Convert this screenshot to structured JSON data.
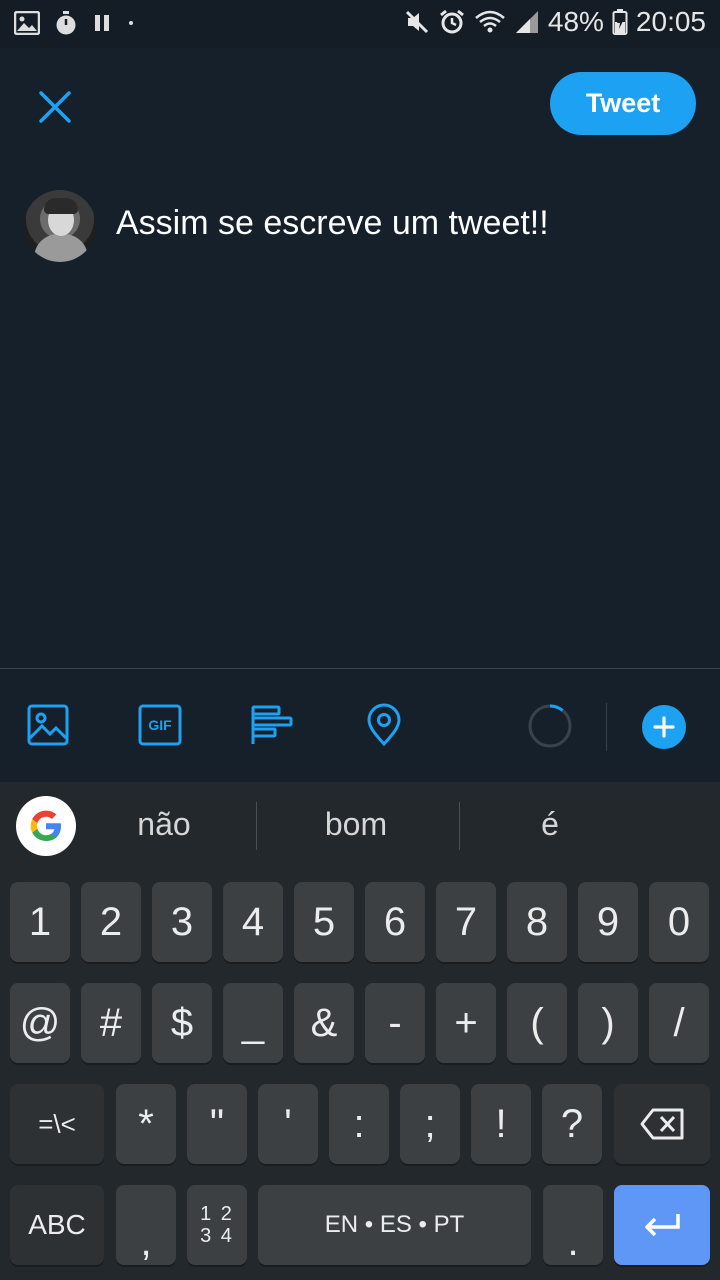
{
  "status_bar": {
    "battery_percent": "48%",
    "time": "20:05",
    "left_icons": [
      "image-icon",
      "stopwatch-icon",
      "pause-icon",
      "dot-icon"
    ],
    "right_icons": [
      "mute-icon",
      "alarm-icon",
      "wifi-icon",
      "signal-icon",
      "battery-icon"
    ]
  },
  "compose": {
    "tweet_label": "Tweet",
    "text": "Assim se escreve um tweet!!"
  },
  "toolbar": {
    "gif_label": "GIF"
  },
  "keyboard": {
    "suggestions": [
      "não",
      "bom",
      "é"
    ],
    "row1": [
      "1",
      "2",
      "3",
      "4",
      "5",
      "6",
      "7",
      "8",
      "9",
      "0"
    ],
    "row2": [
      "@",
      "#",
      "$",
      "_",
      "&",
      "-",
      "+",
      "(",
      ")",
      "/"
    ],
    "row3": [
      "=\\<",
      "*",
      "\"",
      "'",
      ":",
      ";",
      "!",
      "?"
    ],
    "abc_label": "ABC",
    "comma": ",",
    "numpad_top": "1 2",
    "numpad_bottom": "3 4",
    "space_label": "EN • ES • PT",
    "period": "."
  },
  "colors": {
    "accent": "#1da1f2",
    "background": "#15202b",
    "enter_key": "#5e97f6"
  }
}
